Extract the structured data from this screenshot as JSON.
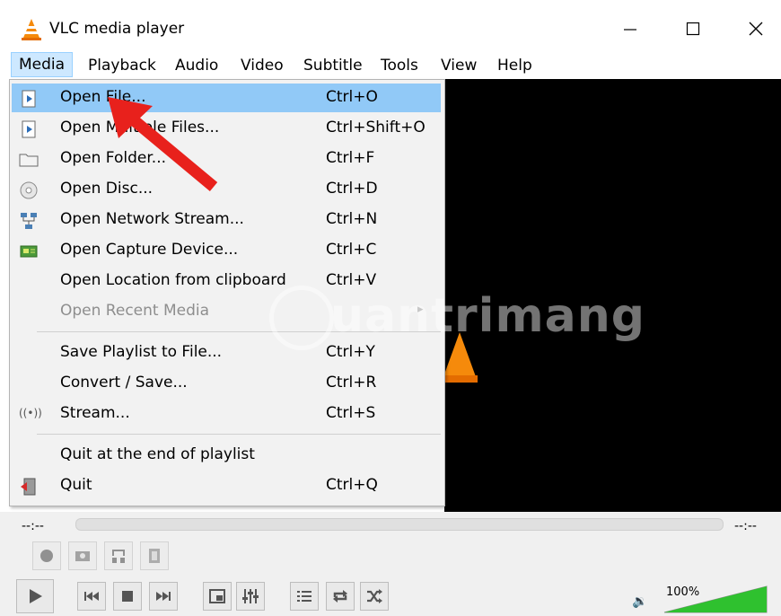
{
  "window": {
    "title": "VLC media player"
  },
  "menubar": [
    "Media",
    "Playback",
    "Audio",
    "Video",
    "Subtitle",
    "Tools",
    "View",
    "Help"
  ],
  "media_menu": {
    "items": [
      {
        "label": "Open File...",
        "shortcut": "Ctrl+O",
        "icon": "play-file-icon"
      },
      {
        "label": "Open Multiple Files...",
        "shortcut": "Ctrl+Shift+O",
        "icon": "play-file-icon"
      },
      {
        "label": "Open Folder...",
        "shortcut": "Ctrl+F",
        "icon": "folder-icon"
      },
      {
        "label": "Open Disc...",
        "shortcut": "Ctrl+D",
        "icon": "disc-icon"
      },
      {
        "label": "Open Network Stream...",
        "shortcut": "Ctrl+N",
        "icon": "network-icon"
      },
      {
        "label": "Open Capture Device...",
        "shortcut": "Ctrl+C",
        "icon": "capture-card-icon"
      },
      {
        "label": "Open Location from clipboard",
        "shortcut": "Ctrl+V",
        "icon": ""
      },
      {
        "label": "Open Recent Media",
        "shortcut": "",
        "icon": ""
      },
      {
        "label": "Save Playlist to File...",
        "shortcut": "Ctrl+Y",
        "icon": ""
      },
      {
        "label": "Convert / Save...",
        "shortcut": "Ctrl+R",
        "icon": ""
      },
      {
        "label": "Stream...",
        "shortcut": "Ctrl+S",
        "icon": "stream-icon"
      },
      {
        "label": "Quit at the end of playlist",
        "shortcut": "",
        "icon": ""
      },
      {
        "label": "Quit",
        "shortcut": "Ctrl+Q",
        "icon": "quit-icon"
      }
    ],
    "highlighted_index": 0,
    "disabled_index": 7
  },
  "watermark": "uantrimang",
  "player": {
    "elapsed": "--:--",
    "remaining": "--:--",
    "volume": "100%",
    "volume_level": 1.0
  },
  "colors": {
    "highlight": "#91c9f7",
    "annotation_arrow": "#e8211c",
    "volume_green": "#2fc12f"
  }
}
